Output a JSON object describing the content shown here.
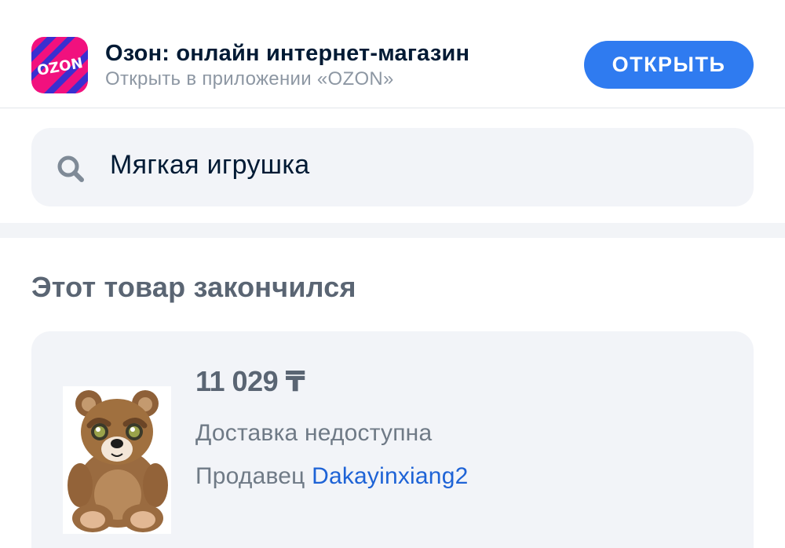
{
  "banner": {
    "app_title": "Озон: онлайн интернет-магазин",
    "app_subtitle": "Открыть в приложении «OZON»",
    "logo_text": "OZON",
    "logo_icon": "ozon-logo-icon",
    "open_button_label": "ОТКРЫТЬ",
    "colors": {
      "button": "#2f7bf0",
      "logo_pink": "#f1117e",
      "logo_blue": "#005bff"
    }
  },
  "search": {
    "icon": "search-icon",
    "query": "Мягкая игрушка"
  },
  "status": {
    "heading": "Этот товар закончился"
  },
  "product": {
    "price": "11 029 ₸",
    "delivery": "Доставка недоступна",
    "seller_label": "Продавец",
    "seller_name": "Dakayinxiang2",
    "image": "teddy-bear-toy"
  }
}
